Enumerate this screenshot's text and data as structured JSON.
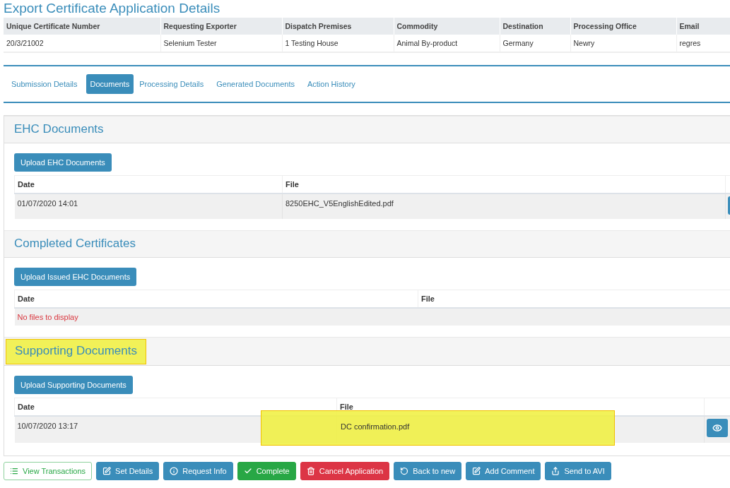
{
  "page_title": "Export Certificate Application Details",
  "summary_table": {
    "columns": [
      "Unique Certificate Number",
      "Requesting Exporter",
      "Dispatch Premises",
      "Commodity",
      "Destination",
      "Processing Office",
      "Email"
    ],
    "row": [
      "20/3/21002",
      "Selenium Tester",
      "1 Testing House",
      "Animal By-product",
      "Germany",
      "Newry",
      "regres"
    ]
  },
  "tabs": [
    {
      "label": "Submission Details",
      "selected": false
    },
    {
      "label": "Documents",
      "selected": true
    },
    {
      "label": "Processing Details",
      "selected": false
    },
    {
      "label": "Generated Documents",
      "selected": false
    },
    {
      "label": "Action History",
      "selected": false
    }
  ],
  "sections": [
    {
      "title": "EHC Documents",
      "highlighted": false,
      "upload_button": "Upload EHC Documents",
      "columns": [
        "Date",
        "File"
      ],
      "rows": [
        {
          "date": "01/07/2020 14:01",
          "file": "8250EHC_V5EnglishEdited.pdf",
          "highlighted": false
        }
      ]
    },
    {
      "title": "Completed Certificates",
      "highlighted": false,
      "upload_button": "Upload Issued EHC Documents",
      "columns": [
        "Date",
        "File"
      ],
      "empty_message": "No files to display"
    },
    {
      "title": "Supporting Documents",
      "highlighted": true,
      "upload_button": "Upload Supporting Documents",
      "columns": [
        "Date",
        "File"
      ],
      "rows": [
        {
          "date": "10/07/2020 13:17",
          "file": "DC confirmation.pdf",
          "highlighted": true
        }
      ]
    }
  ],
  "actions": [
    {
      "label": "View Transactions",
      "kind": "outline-success"
    },
    {
      "label": "Set Details",
      "kind": "primary"
    },
    {
      "label": "Request Info",
      "kind": "primary"
    },
    {
      "label": "Complete",
      "kind": "success"
    },
    {
      "label": "Cancel Application",
      "kind": "danger"
    },
    {
      "label": "Back to new",
      "kind": "primary"
    },
    {
      "label": "Add Comment",
      "kind": "primary"
    },
    {
      "label": "Send to AVI",
      "kind": "primary"
    }
  ]
}
